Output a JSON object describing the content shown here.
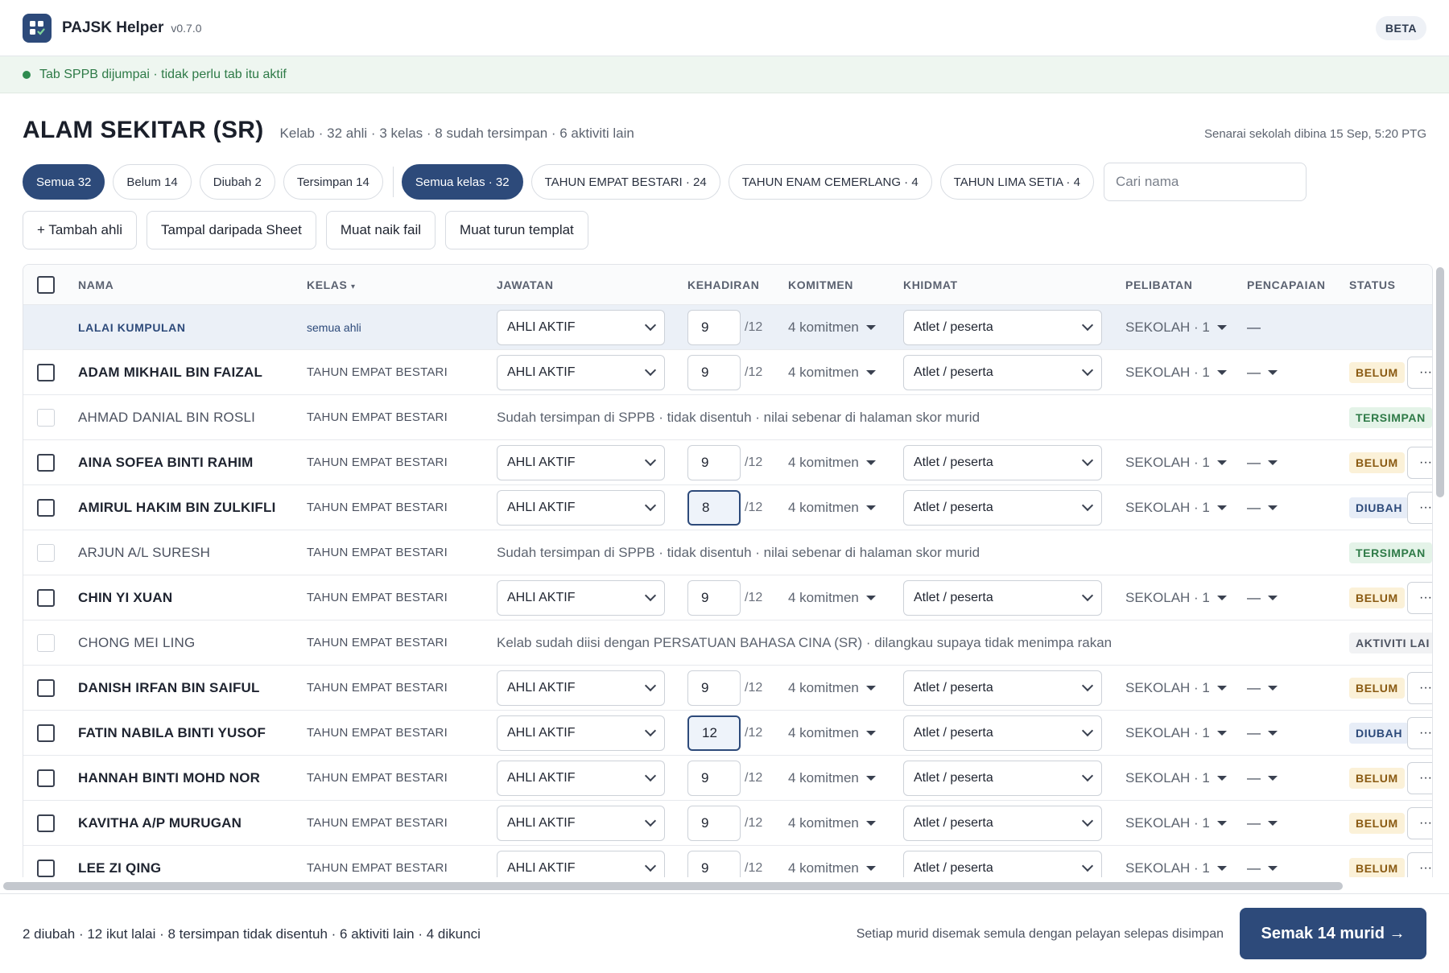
{
  "app": {
    "title": "PAJSK Helper",
    "version": "v0.7.0",
    "beta": "BETA"
  },
  "banner": {
    "text": "Tab SPPB dijumpai · tidak perlu tab itu aktif"
  },
  "page": {
    "title": "ALAM SEKITAR (SR)",
    "subtitle": "Kelab · 32 ahli · 3 kelas · 8 sudah tersimpan · 6 aktiviti lain",
    "built_at": "Senarai sekolah dibina 15 Sep, 5:20 PTG"
  },
  "filters": {
    "status": [
      "Semua 32",
      "Belum 14",
      "Diubah 2",
      "Tersimpan 14"
    ],
    "classes": [
      "Semua kelas · 32",
      "TAHUN EMPAT BESTARI · 24",
      "TAHUN ENAM CEMERLANG · 4",
      "TAHUN LIMA SETIA · 4"
    ],
    "search_placeholder": "Cari nama"
  },
  "actions": {
    "add": "+ Tambah ahli",
    "paste": "Tampal daripada Sheet",
    "upload": "Muat naik fail",
    "download": "Muat turun templat"
  },
  "table": {
    "headers": {
      "nama": "NAMA",
      "kelas": "KELAS",
      "kelas_sort": "▾",
      "jawatan": "JAWATAN",
      "kehadiran": "KEHADIRAN",
      "komitmen": "KOMITMEN",
      "khidmat": "KHIDMAT",
      "pelibatan": "PELIBATAN",
      "pencapaian": "PENCAPAIAN",
      "status": "STATUS"
    },
    "group_row": {
      "label": "LALAI KUMPULAN",
      "kelas": "semua ahli",
      "jawatan": "AHLI AKTIF",
      "kehadiran": "9",
      "max": "/12",
      "komitmen": "4 komitmen",
      "khidmat": "Atlet / peserta",
      "pelibatan": "SEKOLAH · 1",
      "pencapaian": "—"
    },
    "rows": [
      {
        "name": "ADAM MIKHAIL BIN FAIZAL",
        "kelas": "TAHUN EMPAT BESTARI",
        "type": "edit",
        "jawatan": "AHLI AKTIF",
        "kehadiran": "9",
        "max": "/12",
        "komitmen": "4 komitmen",
        "khidmat": "Atlet / peserta",
        "pelibatan": "SEKOLAH · 1",
        "pencapaian": "—",
        "status": "BELUM",
        "more": "···"
      },
      {
        "name": "AHMAD DANIAL BIN ROSLI",
        "kelas": "TAHUN EMPAT BESTARI",
        "type": "note",
        "note": "Sudah tersimpan di SPPB · tidak disentuh · nilai sebenar di halaman skor murid",
        "status": "TERSIMPAN"
      },
      {
        "name": "AINA SOFEA BINTI RAHIM",
        "kelas": "TAHUN EMPAT BESTARI",
        "type": "edit",
        "jawatan": "AHLI AKTIF",
        "kehadiran": "9",
        "max": "/12",
        "komitmen": "4 komitmen",
        "khidmat": "Atlet / peserta",
        "pelibatan": "SEKOLAH · 1",
        "pencapaian": "—",
        "status": "BELUM",
        "more": "···"
      },
      {
        "name": "AMIRUL HAKIM BIN ZULKIFLI",
        "kelas": "TAHUN EMPAT BESTARI",
        "type": "edit",
        "jawatan": "AHLI AKTIF",
        "kehadiran": "8",
        "changed": true,
        "max": "/12",
        "komitmen": "4 komitmen",
        "khidmat": "Atlet / peserta",
        "pelibatan": "SEKOLAH · 1",
        "pencapaian": "—",
        "status": "DIUBAH",
        "more": "···"
      },
      {
        "name": "ARJUN A/L SURESH",
        "kelas": "TAHUN EMPAT BESTARI",
        "type": "note",
        "note": "Sudah tersimpan di SPPB · tidak disentuh · nilai sebenar di halaman skor murid",
        "status": "TERSIMPAN"
      },
      {
        "name": "CHIN YI XUAN",
        "kelas": "TAHUN EMPAT BESTARI",
        "type": "edit",
        "jawatan": "AHLI AKTIF",
        "kehadiran": "9",
        "max": "/12",
        "komitmen": "4 komitmen",
        "khidmat": "Atlet / peserta",
        "pelibatan": "SEKOLAH · 1",
        "pencapaian": "—",
        "status": "BELUM",
        "more": "···"
      },
      {
        "name": "CHONG MEI LING",
        "kelas": "TAHUN EMPAT BESTARI",
        "type": "note",
        "note": "Kelab sudah diisi dengan PERSATUAN BAHASA CINA (SR) · dilangkau supaya tidak menimpa rakan",
        "status": "AKTIVITI LAI"
      },
      {
        "name": "DANISH IRFAN BIN SAIFUL",
        "kelas": "TAHUN EMPAT BESTARI",
        "type": "edit",
        "jawatan": "AHLI AKTIF",
        "kehadiran": "9",
        "max": "/12",
        "komitmen": "4 komitmen",
        "khidmat": "Atlet / peserta",
        "pelibatan": "SEKOLAH · 1",
        "pencapaian": "—",
        "status": "BELUM",
        "more": "···"
      },
      {
        "name": "FATIN NABILA BINTI YUSOF",
        "kelas": "TAHUN EMPAT BESTARI",
        "type": "edit",
        "jawatan": "AHLI AKTIF",
        "kehadiran": "12",
        "changed": true,
        "max": "/12",
        "komitmen": "4 komitmen",
        "khidmat": "Atlet / peserta",
        "pelibatan": "SEKOLAH · 1",
        "pencapaian": "—",
        "status": "DIUBAH",
        "more": "···"
      },
      {
        "name": "HANNAH BINTI MOHD NOR",
        "kelas": "TAHUN EMPAT BESTARI",
        "type": "edit",
        "jawatan": "AHLI AKTIF",
        "kehadiran": "9",
        "max": "/12",
        "komitmen": "4 komitmen",
        "khidmat": "Atlet / peserta",
        "pelibatan": "SEKOLAH · 1",
        "pencapaian": "—",
        "status": "BELUM",
        "more": "···"
      },
      {
        "name": "KAVITHA A/P MURUGAN",
        "kelas": "TAHUN EMPAT BESTARI",
        "type": "edit",
        "jawatan": "AHLI AKTIF",
        "kehadiran": "9",
        "max": "/12",
        "komitmen": "4 komitmen",
        "khidmat": "Atlet / peserta",
        "pelibatan": "SEKOLAH · 1",
        "pencapaian": "—",
        "status": "BELUM",
        "more": "···"
      },
      {
        "name": "LEE ZI QING",
        "kelas": "TAHUN EMPAT BESTARI",
        "type": "edit",
        "jawatan": "AHLI AKTIF",
        "kehadiran": "9",
        "max": "/12",
        "komitmen": "4 komitmen",
        "khidmat": "Atlet / peserta",
        "pelibatan": "SEKOLAH · 1",
        "pencapaian": "—",
        "status": "BELUM",
        "more": "···"
      }
    ]
  },
  "footer": {
    "summary": "2 diubah · 12 ikut lalai · 8 tersimpan tidak disentuh · 6 aktiviti lain · 4 dikunci",
    "note": "Setiap murid disemak semula dengan pelayan selepas disimpan",
    "primary": "Semak 14 murid →"
  },
  "colors": {
    "accent": "#2d4a7a",
    "success": "#2e7a47",
    "warning": "#8a5a12"
  }
}
